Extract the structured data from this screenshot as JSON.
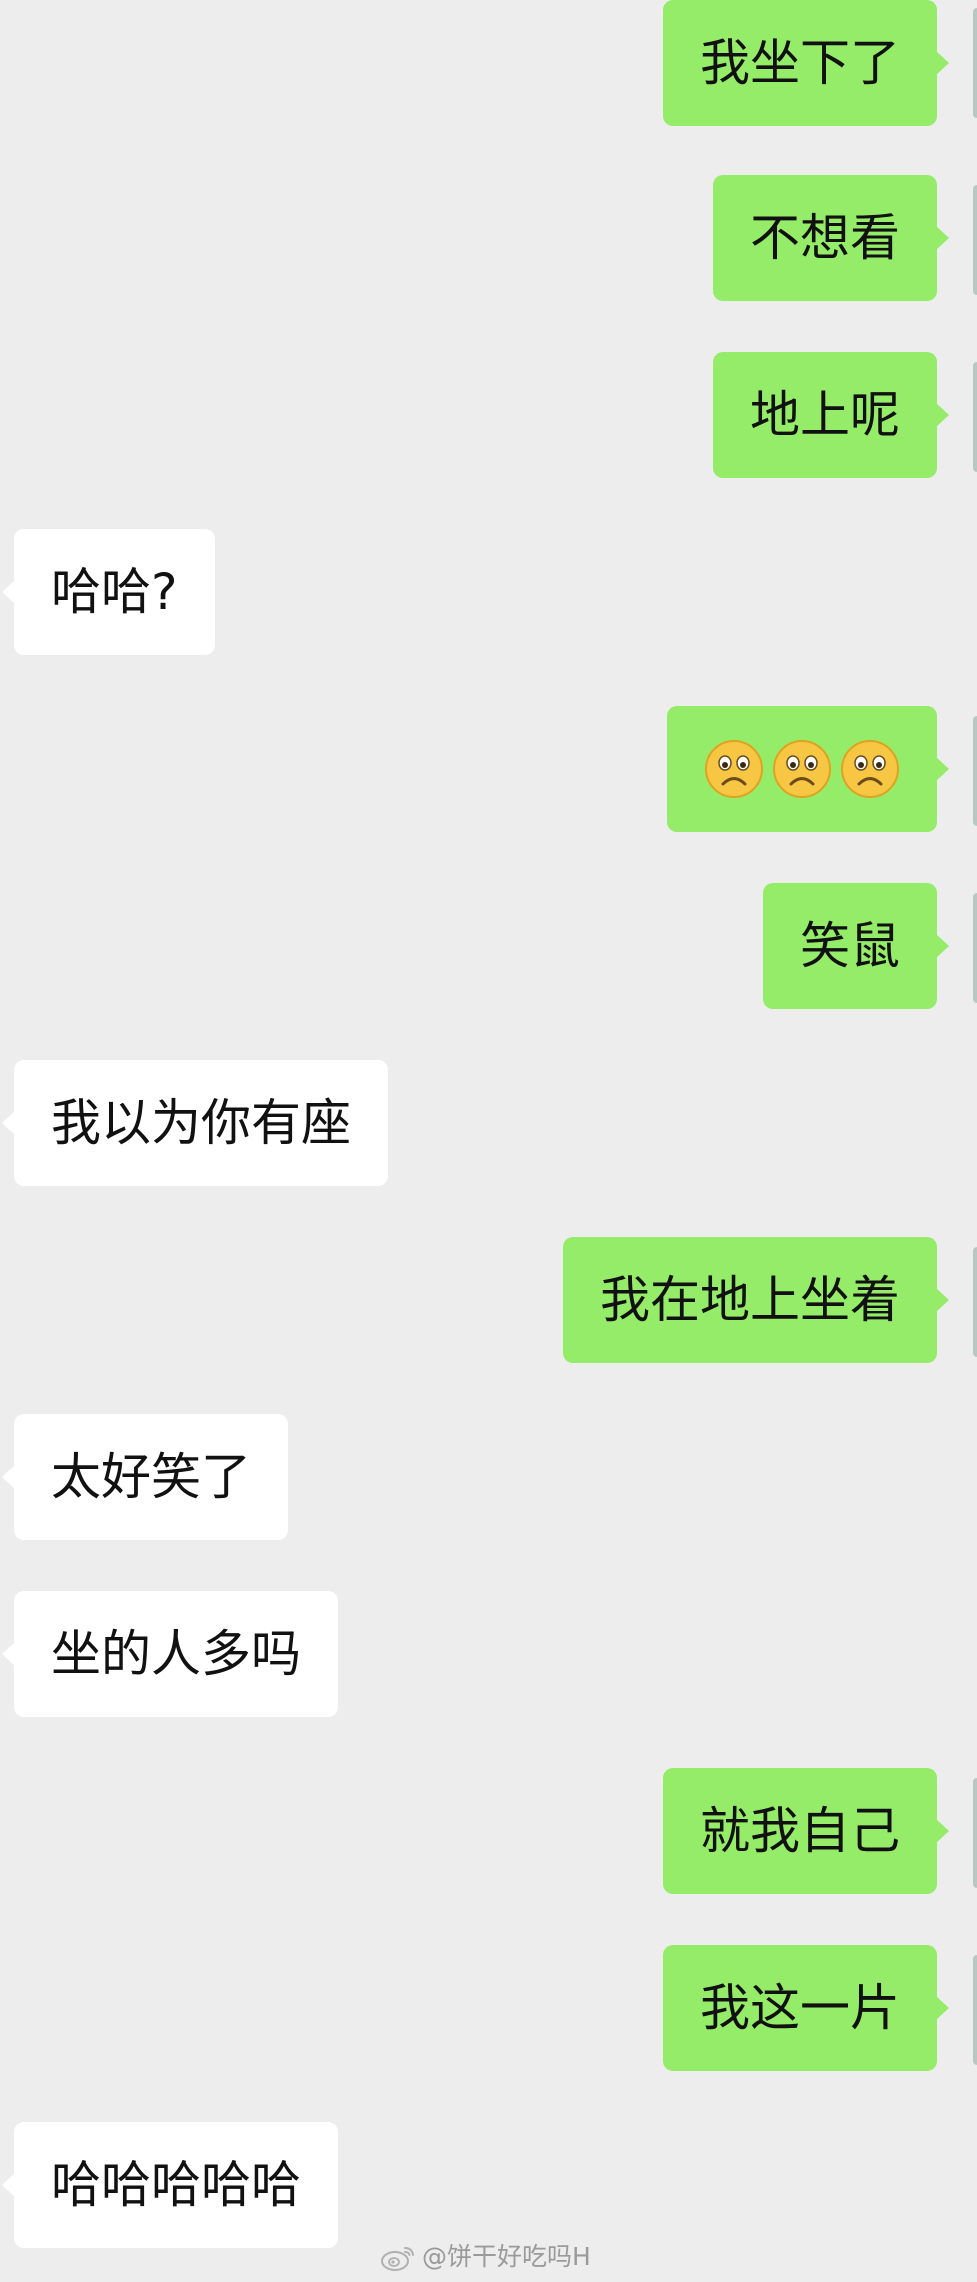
{
  "messages": [
    {
      "side": "self",
      "text": "我坐下了"
    },
    {
      "side": "self",
      "text": "不想看"
    },
    {
      "side": "self",
      "text": "地上呢"
    },
    {
      "side": "other",
      "text": "哈哈?"
    },
    {
      "side": "self",
      "emoji": [
        "frowning-face",
        "frowning-face",
        "frowning-face"
      ]
    },
    {
      "side": "self",
      "text": "笑鼠"
    },
    {
      "side": "other",
      "text": "我以为你有座"
    },
    {
      "side": "self",
      "text": "我在地上坐着"
    },
    {
      "side": "other",
      "text": "太好笑了"
    },
    {
      "side": "other",
      "text": "坐的人多吗"
    },
    {
      "side": "self",
      "text": "就我自己"
    },
    {
      "side": "self",
      "text": "我这一片"
    },
    {
      "side": "other",
      "text": "哈哈哈哈哈"
    }
  ],
  "watermark": {
    "text": "@饼干好吃吗H",
    "icon": "weibo-icon"
  },
  "colors": {
    "background": "#ededed",
    "self_bubble": "#95ec69",
    "other_bubble": "#ffffff",
    "text": "#111111",
    "watermark": "#9a9a9a"
  }
}
